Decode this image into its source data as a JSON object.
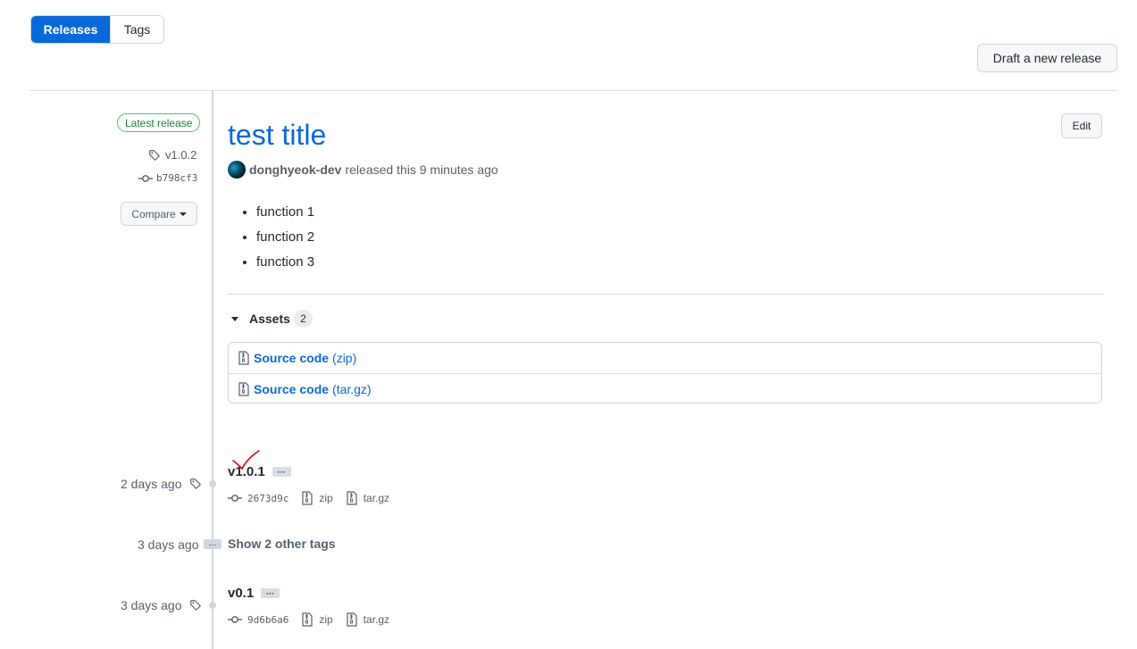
{
  "tabs": [
    {
      "label": "Releases",
      "selected": true
    },
    {
      "label": "Tags",
      "selected": false
    }
  ],
  "actions": {
    "draft_release": "Draft a new release",
    "edit": "Edit",
    "compare": "Compare"
  },
  "latest": {
    "badge": "Latest release",
    "tag": "v1.0.2",
    "commit": "b798cf3",
    "title": "test title",
    "author": "donghyeok-dev",
    "released_text": "released this 9 minutes ago",
    "notes": [
      "function 1",
      "function 2",
      "function 3"
    ],
    "assets": {
      "label": "Assets",
      "count": "2",
      "items": [
        {
          "name": "Source code",
          "ext": "(zip)"
        },
        {
          "name": "Source code",
          "ext": "(tar.gz)"
        }
      ]
    }
  },
  "tags": [
    {
      "time": "2 days ago",
      "name": "v1.0.1",
      "commit": "2673d9c",
      "zip": "zip",
      "targz": "tar.gz"
    },
    {
      "time": "3 days ago",
      "name": "v0.1",
      "commit": "9d6b6a6",
      "zip": "zip",
      "targz": "tar.gz"
    }
  ],
  "other_tags": {
    "time": "3 days ago",
    "label": "Show 2 other tags"
  },
  "ellipsis": "···",
  "colors": {
    "accent": "#0969da",
    "success": "#1a7f37",
    "annotation": "#e00000"
  }
}
